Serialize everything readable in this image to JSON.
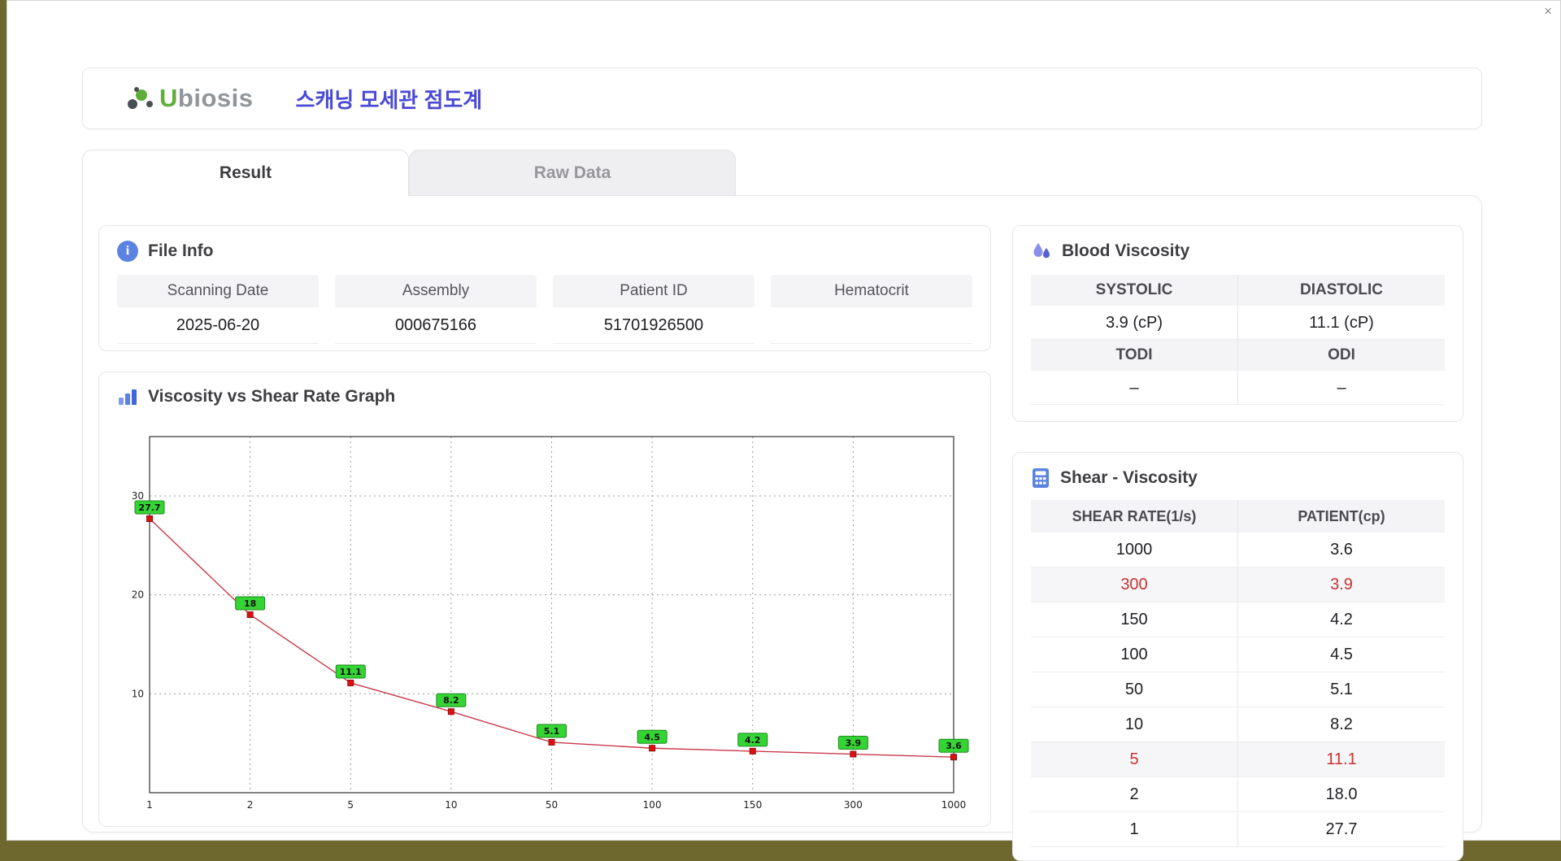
{
  "window": {
    "close_glyph": "×"
  },
  "header": {
    "logo_first": "U",
    "logo_rest": "biosis",
    "title": "스캐닝 모세관 점도계"
  },
  "tabs": [
    {
      "label": "Result",
      "active": true
    },
    {
      "label": "Raw Data",
      "active": false
    }
  ],
  "icons": {
    "info_glyph": "i"
  },
  "file_info": {
    "title": "File Info",
    "fields": [
      {
        "label": "Scanning Date",
        "value": "2025-06-20"
      },
      {
        "label": "Assembly",
        "value": "000675166"
      },
      {
        "label": "Patient ID",
        "value": "51701926500"
      },
      {
        "label": "Hematocrit",
        "value": ""
      }
    ]
  },
  "graph": {
    "title": "Viscosity vs Shear Rate Graph"
  },
  "chart_data": {
    "type": "line",
    "title": "Viscosity vs Shear Rate Graph",
    "x": [
      1,
      2,
      5,
      10,
      50,
      100,
      150,
      300,
      1000
    ],
    "values": [
      27.7,
      18,
      11.1,
      8.2,
      5.1,
      4.5,
      4.2,
      3.9,
      3.6
    ],
    "point_labels": [
      "27.7",
      "18",
      "11.1",
      "8.2",
      "5.1",
      "4.5",
      "4.2",
      "3.9",
      "3.6"
    ],
    "x_ticks": [
      "1",
      "2",
      "5",
      "10",
      "50",
      "100",
      "150",
      "300",
      "1000"
    ],
    "y_ticks": [
      10,
      20,
      30
    ],
    "ylim": [
      0,
      36
    ],
    "x_axis_type": "categorical-equal-spacing",
    "xlabel": "",
    "ylabel": "",
    "grid": "dashed",
    "legend": "none",
    "line_color": "#c9394b",
    "marker_color": "#e01010",
    "label_bg": "#35d435"
  },
  "blood_viscosity": {
    "title": "Blood Viscosity",
    "cells": [
      {
        "label": "SYSTOLIC",
        "value": "3.9 (cP)"
      },
      {
        "label": "DIASTOLIC",
        "value": "11.1 (cP)"
      },
      {
        "label": "TODI",
        "value": "–"
      },
      {
        "label": "ODI",
        "value": "–"
      }
    ]
  },
  "shear_viscosity": {
    "title": "Shear - Viscosity",
    "columns": [
      "SHEAR RATE(1/s)",
      "PATIENT(cp)"
    ],
    "rows": [
      {
        "shear": "1000",
        "patient": "3.6",
        "highlight": false
      },
      {
        "shear": "300",
        "patient": "3.9",
        "highlight": true
      },
      {
        "shear": "150",
        "patient": "4.2",
        "highlight": false
      },
      {
        "shear": "100",
        "patient": "4.5",
        "highlight": false
      },
      {
        "shear": "50",
        "patient": "5.1",
        "highlight": false
      },
      {
        "shear": "10",
        "patient": "8.2",
        "highlight": false
      },
      {
        "shear": "5",
        "patient": "11.1",
        "highlight": true
      },
      {
        "shear": "2",
        "patient": "18.0",
        "highlight": false
      },
      {
        "shear": "1",
        "patient": "27.7",
        "highlight": false
      }
    ]
  }
}
